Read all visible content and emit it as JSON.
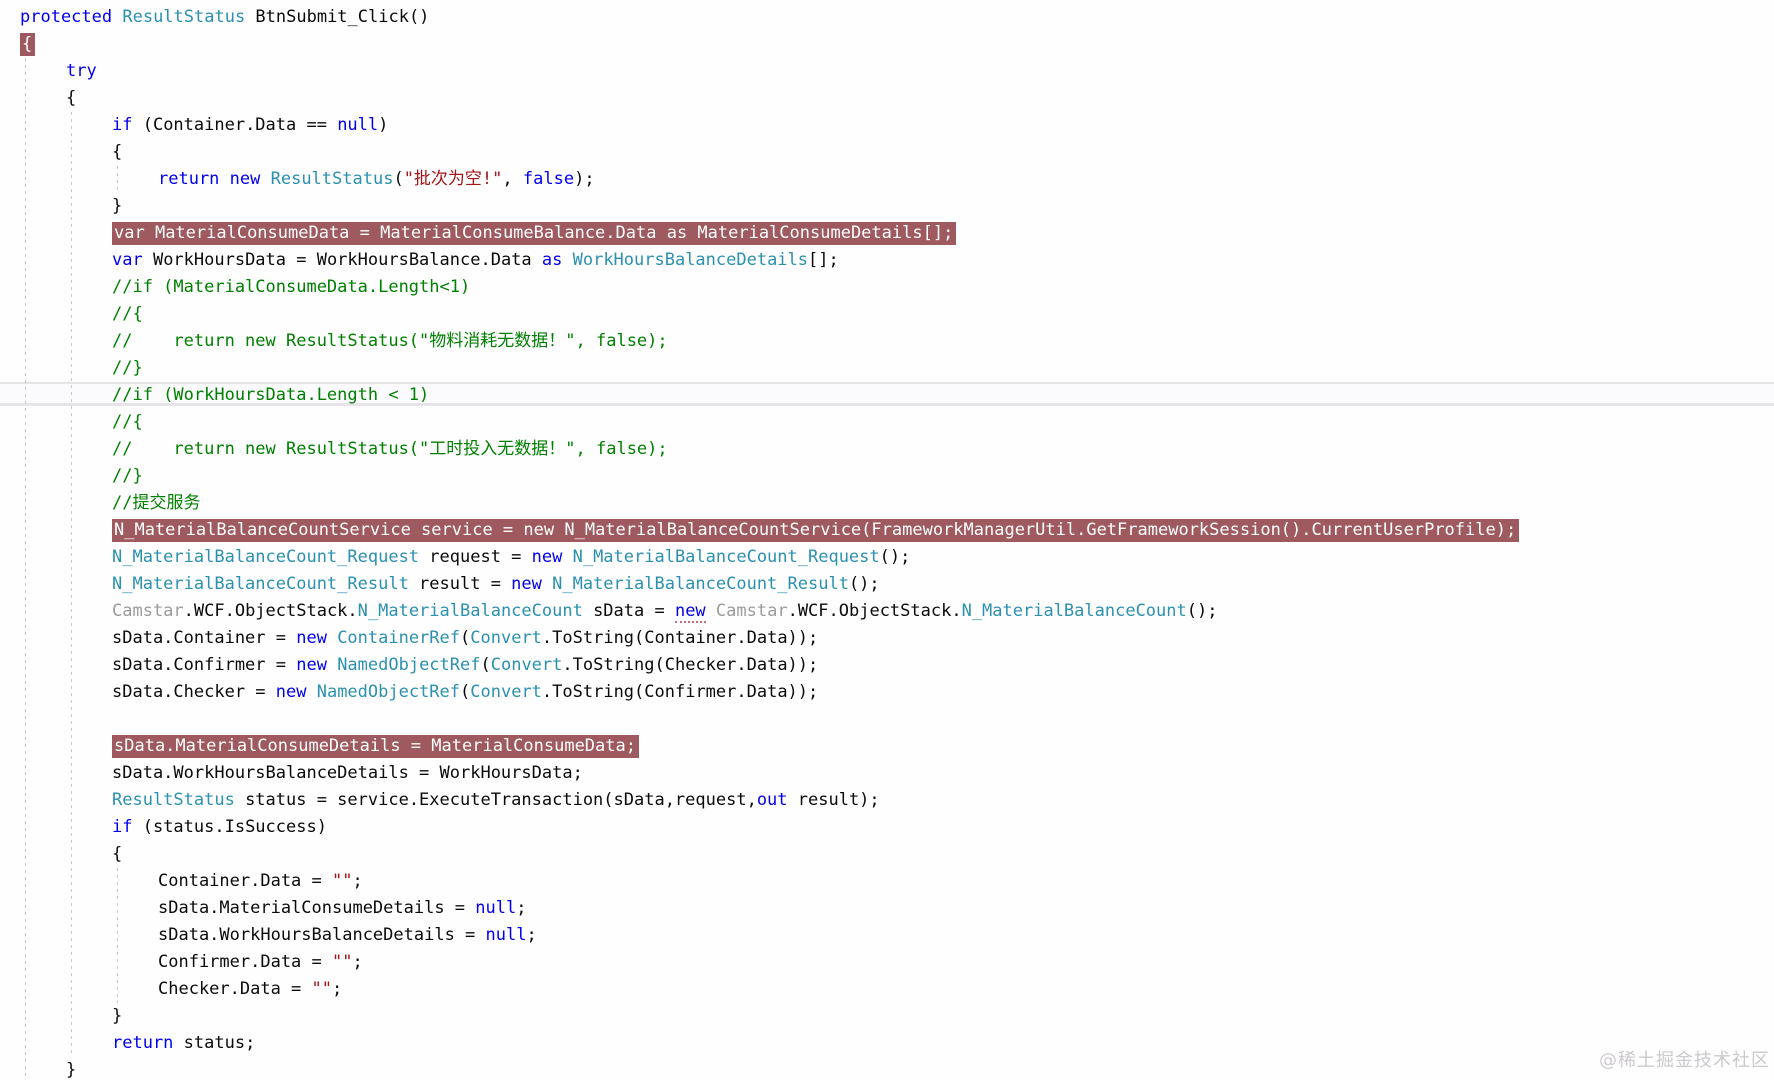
{
  "editor": {
    "language": "csharp",
    "highlight_color": "#9e5a5e",
    "colors": {
      "keyword": "#0000f0",
      "type": "#2b91af",
      "string": "#a31515",
      "comment": "#008000",
      "plain": "#0a0a0a",
      "gray": "#9b9b9b"
    },
    "lines": [
      {
        "indent": 0,
        "hl": false,
        "tokens": [
          [
            "keyword",
            "protected "
          ],
          [
            "type",
            "ResultStatus "
          ],
          [
            "plain",
            "BtnSubmit_Click()"
          ]
        ]
      },
      {
        "indent": 0,
        "hl": true,
        "tokens": [
          [
            "plain",
            "{"
          ]
        ]
      },
      {
        "indent": 1,
        "hl": false,
        "tokens": [
          [
            "keyword",
            "try"
          ]
        ]
      },
      {
        "indent": 1,
        "hl": false,
        "tokens": [
          [
            "plain",
            "{"
          ]
        ]
      },
      {
        "indent": 2,
        "hl": false,
        "tokens": [
          [
            "keyword",
            "if "
          ],
          [
            "plain",
            "(Container.Data == "
          ],
          [
            "keyword",
            "null"
          ],
          [
            "plain",
            ")"
          ]
        ]
      },
      {
        "indent": 2,
        "hl": false,
        "tokens": [
          [
            "plain",
            "{"
          ]
        ]
      },
      {
        "indent": 3,
        "hl": false,
        "tokens": [
          [
            "keyword",
            "return "
          ],
          [
            "keyword",
            "new "
          ],
          [
            "type",
            "ResultStatus"
          ],
          [
            "plain",
            "("
          ],
          [
            "string",
            "\"批次为空!\""
          ],
          [
            "plain",
            ", "
          ],
          [
            "keyword",
            "false"
          ],
          [
            "plain",
            ");"
          ]
        ]
      },
      {
        "indent": 2,
        "hl": false,
        "tokens": [
          [
            "plain",
            "}"
          ]
        ]
      },
      {
        "indent": 2,
        "hl": true,
        "tokens": [
          [
            "keyword",
            "var "
          ],
          [
            "plain",
            "MaterialConsumeData = MaterialConsumeBalance.Data "
          ],
          [
            "keyword",
            "as "
          ],
          [
            "type",
            "MaterialConsumeDetails"
          ],
          [
            "plain",
            "[];"
          ]
        ]
      },
      {
        "indent": 2,
        "hl": false,
        "tokens": [
          [
            "keyword",
            "var "
          ],
          [
            "plain",
            "WorkHoursData = WorkHoursBalance.Data "
          ],
          [
            "keyword",
            "as "
          ],
          [
            "type",
            "WorkHoursBalanceDetails"
          ],
          [
            "plain",
            "[];"
          ]
        ]
      },
      {
        "indent": 2,
        "hl": false,
        "tokens": [
          [
            "comment",
            "//if (MaterialConsumeData.Length<1)"
          ]
        ]
      },
      {
        "indent": 2,
        "hl": false,
        "tokens": [
          [
            "comment",
            "//{"
          ]
        ]
      },
      {
        "indent": 2,
        "hl": false,
        "tokens": [
          [
            "comment",
            "//    return new ResultStatus(\"物料消耗无数据！\", false);"
          ]
        ]
      },
      {
        "indent": 2,
        "hl": false,
        "tokens": [
          [
            "comment",
            "//}"
          ]
        ]
      },
      {
        "indent": 2,
        "hl": false,
        "tokens": [
          [
            "comment",
            "//if (WorkHoursData.Length < 1)"
          ]
        ]
      },
      {
        "indent": 2,
        "hl": false,
        "tokens": [
          [
            "comment",
            "//{"
          ]
        ]
      },
      {
        "indent": 2,
        "hl": false,
        "tokens": [
          [
            "comment",
            "//    return new ResultStatus(\"工时投入无数据！\", false);"
          ]
        ]
      },
      {
        "indent": 2,
        "hl": false,
        "tokens": [
          [
            "comment",
            "//}"
          ]
        ]
      },
      {
        "indent": 2,
        "hl": false,
        "tokens": [
          [
            "comment",
            "//提交服务"
          ]
        ]
      },
      {
        "indent": 2,
        "hl": true,
        "tokens": [
          [
            "type",
            "N_MaterialBalanceCountService "
          ],
          [
            "plain",
            "service = "
          ],
          [
            "keyword",
            "new "
          ],
          [
            "type",
            "N_MaterialBalanceCountService"
          ],
          [
            "plain",
            "(FrameworkManagerUtil.GetFrameworkSession().CurrentUserProfile);"
          ]
        ]
      },
      {
        "indent": 2,
        "hl": false,
        "tokens": [
          [
            "type",
            "N_MaterialBalanceCount_Request "
          ],
          [
            "plain",
            "request = "
          ],
          [
            "keyword",
            "new "
          ],
          [
            "type",
            "N_MaterialBalanceCount_Request"
          ],
          [
            "plain",
            "();"
          ]
        ]
      },
      {
        "indent": 2,
        "hl": false,
        "tokens": [
          [
            "type",
            "N_MaterialBalanceCount_Result "
          ],
          [
            "plain",
            "result = "
          ],
          [
            "keyword",
            "new "
          ],
          [
            "type",
            "N_MaterialBalanceCount_Result"
          ],
          [
            "plain",
            "();"
          ]
        ]
      },
      {
        "indent": 2,
        "hl": false,
        "tokens": [
          [
            "gray",
            "Camstar"
          ],
          [
            "plain",
            ".WCF.ObjectStack."
          ],
          [
            "type",
            "N_MaterialBalanceCount "
          ],
          [
            "plain",
            "sData = "
          ],
          [
            "keyword dots",
            "new"
          ],
          [
            "plain",
            " "
          ],
          [
            "gray",
            "Camstar"
          ],
          [
            "plain",
            ".WCF.ObjectStack."
          ],
          [
            "type",
            "N_MaterialBalanceCount"
          ],
          [
            "plain",
            "();"
          ]
        ]
      },
      {
        "indent": 2,
        "hl": false,
        "tokens": [
          [
            "plain",
            "sData.Container = "
          ],
          [
            "keyword",
            "new "
          ],
          [
            "type",
            "ContainerRef"
          ],
          [
            "plain",
            "("
          ],
          [
            "type",
            "Convert"
          ],
          [
            "plain",
            ".ToString(Container.Data));"
          ]
        ]
      },
      {
        "indent": 2,
        "hl": false,
        "tokens": [
          [
            "plain",
            "sData.Confirmer = "
          ],
          [
            "keyword",
            "new "
          ],
          [
            "type",
            "NamedObjectRef"
          ],
          [
            "plain",
            "("
          ],
          [
            "type",
            "Convert"
          ],
          [
            "plain",
            ".ToString(Checker.Data));"
          ]
        ]
      },
      {
        "indent": 2,
        "hl": false,
        "tokens": [
          [
            "plain",
            "sData.Checker = "
          ],
          [
            "keyword",
            "new "
          ],
          [
            "type",
            "NamedObjectRef"
          ],
          [
            "plain",
            "("
          ],
          [
            "type",
            "Convert"
          ],
          [
            "plain",
            ".ToString(Confirmer.Data));"
          ]
        ]
      },
      {
        "indent": 0,
        "hl": false,
        "tokens": []
      },
      {
        "indent": 2,
        "hl": true,
        "tokens": [
          [
            "plain",
            "sData.MaterialConsumeDetails = MaterialConsumeData;"
          ]
        ]
      },
      {
        "indent": 2,
        "hl": false,
        "tokens": [
          [
            "plain",
            "sData.WorkHoursBalanceDetails = WorkHoursData;"
          ]
        ]
      },
      {
        "indent": 2,
        "hl": false,
        "tokens": [
          [
            "type",
            "ResultStatus "
          ],
          [
            "plain",
            "status = service.ExecuteTransaction(sData,request,"
          ],
          [
            "keyword",
            "out "
          ],
          [
            "plain",
            "result);"
          ]
        ]
      },
      {
        "indent": 2,
        "hl": false,
        "tokens": [
          [
            "keyword",
            "if "
          ],
          [
            "plain",
            "(status.IsSuccess)"
          ]
        ]
      },
      {
        "indent": 2,
        "hl": false,
        "tokens": [
          [
            "plain",
            "{"
          ]
        ]
      },
      {
        "indent": 3,
        "hl": false,
        "tokens": [
          [
            "plain",
            "Container.Data = "
          ],
          [
            "string",
            "\"\""
          ],
          [
            "plain",
            ";"
          ]
        ]
      },
      {
        "indent": 3,
        "hl": false,
        "tokens": [
          [
            "plain",
            "sData.MaterialConsumeDetails = "
          ],
          [
            "keyword",
            "null"
          ],
          [
            "plain",
            ";"
          ]
        ]
      },
      {
        "indent": 3,
        "hl": false,
        "tokens": [
          [
            "plain",
            "sData.WorkHoursBalanceDetails = "
          ],
          [
            "keyword",
            "null"
          ],
          [
            "plain",
            ";"
          ]
        ]
      },
      {
        "indent": 3,
        "hl": false,
        "tokens": [
          [
            "plain",
            "Confirmer.Data = "
          ],
          [
            "string",
            "\"\""
          ],
          [
            "plain",
            ";"
          ]
        ]
      },
      {
        "indent": 3,
        "hl": false,
        "tokens": [
          [
            "plain",
            "Checker.Data = "
          ],
          [
            "string",
            "\"\""
          ],
          [
            "plain",
            ";"
          ]
        ]
      },
      {
        "indent": 2,
        "hl": false,
        "tokens": [
          [
            "plain",
            "}"
          ]
        ]
      },
      {
        "indent": 2,
        "hl": false,
        "tokens": [
          [
            "keyword",
            "return "
          ],
          [
            "plain",
            "status;"
          ]
        ]
      },
      {
        "indent": 1,
        "hl": false,
        "tokens": [
          [
            "plain",
            "}"
          ]
        ]
      }
    ]
  },
  "watermark": {
    "text": "@稀土掘金技术社区"
  }
}
